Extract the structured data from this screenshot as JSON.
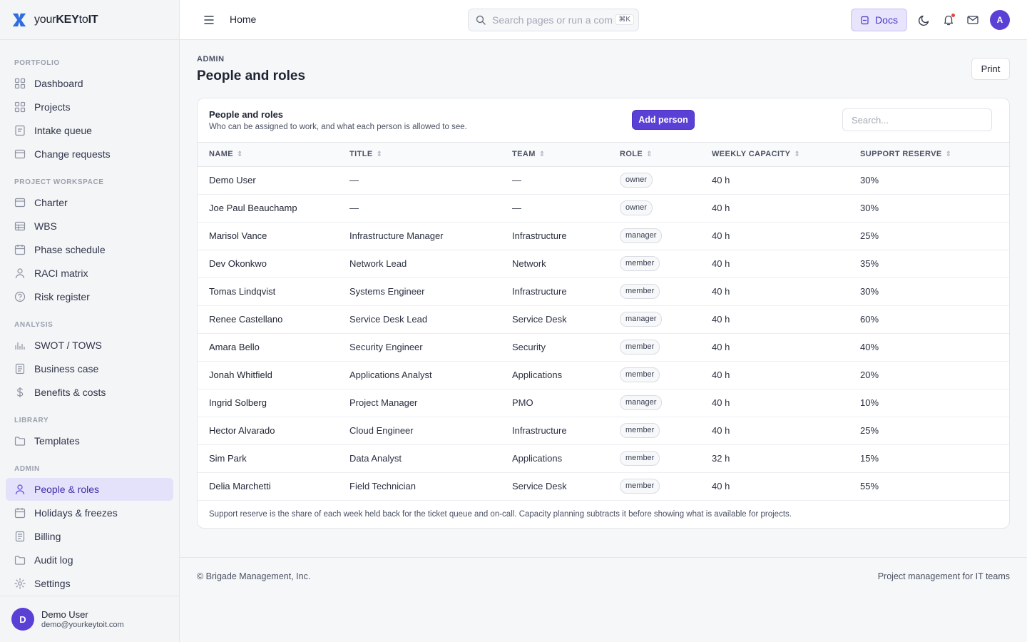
{
  "brand": {
    "prefix": "your",
    "key": "KEY",
    "to": "to",
    "it": "IT"
  },
  "sidebar": {
    "sections": [
      {
        "label": "PORTFOLIO",
        "items": [
          {
            "label": "Dashboard",
            "icon": "grid-icon"
          },
          {
            "label": "Projects",
            "icon": "grid-icon"
          },
          {
            "label": "Intake queue",
            "icon": "form-icon"
          },
          {
            "label": "Change requests",
            "icon": "window-icon"
          }
        ]
      },
      {
        "label": "PROJECT WORKSPACE",
        "items": [
          {
            "label": "Charter",
            "icon": "window-icon"
          },
          {
            "label": "WBS",
            "icon": "table-icon"
          },
          {
            "label": "Phase schedule",
            "icon": "calendar-icon"
          },
          {
            "label": "RACI matrix",
            "icon": "user-icon"
          },
          {
            "label": "Risk register",
            "icon": "help-circle-icon"
          }
        ]
      },
      {
        "label": "ANALYSIS",
        "items": [
          {
            "label": "SWOT / TOWS",
            "icon": "bar-chart-icon"
          },
          {
            "label": "Business case",
            "icon": "document-icon"
          },
          {
            "label": "Benefits & costs",
            "icon": "dollar-icon"
          }
        ]
      },
      {
        "label": "LIBRARY",
        "items": [
          {
            "label": "Templates",
            "icon": "folder-icon"
          }
        ]
      },
      {
        "label": "ADMIN",
        "items": [
          {
            "label": "People & roles",
            "icon": "user-icon",
            "active": true
          },
          {
            "label": "Holidays & freezes",
            "icon": "calendar-icon"
          },
          {
            "label": "Billing",
            "icon": "document-icon"
          },
          {
            "label": "Audit log",
            "icon": "folder-icon"
          },
          {
            "label": "Settings",
            "icon": "gear-icon"
          }
        ]
      }
    ],
    "user": {
      "initial": "D",
      "name": "Demo User",
      "email": "demo@yourkeytoit.com"
    }
  },
  "topbar": {
    "breadcrumb": "Home",
    "search_placeholder": "Search pages or run a command",
    "search_shortcut": "⌘K",
    "docs_label": "Docs",
    "avatar_initial": "A"
  },
  "page": {
    "eyebrow": "ADMIN",
    "title": "People and roles",
    "print_label": "Print"
  },
  "card": {
    "title": "People and roles",
    "subtitle": "Who can be assigned to work, and what each person is allowed to see.",
    "add_label": "Add person",
    "search_placeholder": "Search...",
    "columns": [
      "NAME",
      "TITLE",
      "TEAM",
      "ROLE",
      "WEEKLY CAPACITY",
      "SUPPORT RESERVE"
    ],
    "rows": [
      {
        "name": "Demo User",
        "title": "—",
        "team": "—",
        "role": "owner",
        "capacity": "40 h",
        "reserve": "30%"
      },
      {
        "name": "Joe Paul Beauchamp",
        "title": "—",
        "team": "—",
        "role": "owner",
        "capacity": "40 h",
        "reserve": "30%"
      },
      {
        "name": "Marisol Vance",
        "title": "Infrastructure Manager",
        "team": "Infrastructure",
        "role": "manager",
        "capacity": "40 h",
        "reserve": "25%"
      },
      {
        "name": "Dev Okonkwo",
        "title": "Network Lead",
        "team": "Network",
        "role": "member",
        "capacity": "40 h",
        "reserve": "35%"
      },
      {
        "name": "Tomas Lindqvist",
        "title": "Systems Engineer",
        "team": "Infrastructure",
        "role": "member",
        "capacity": "40 h",
        "reserve": "30%"
      },
      {
        "name": "Renee Castellano",
        "title": "Service Desk Lead",
        "team": "Service Desk",
        "role": "manager",
        "capacity": "40 h",
        "reserve": "60%"
      },
      {
        "name": "Amara Bello",
        "title": "Security Engineer",
        "team": "Security",
        "role": "member",
        "capacity": "40 h",
        "reserve": "40%"
      },
      {
        "name": "Jonah Whitfield",
        "title": "Applications Analyst",
        "team": "Applications",
        "role": "member",
        "capacity": "40 h",
        "reserve": "20%"
      },
      {
        "name": "Ingrid Solberg",
        "title": "Project Manager",
        "team": "PMO",
        "role": "manager",
        "capacity": "40 h",
        "reserve": "10%"
      },
      {
        "name": "Hector Alvarado",
        "title": "Cloud Engineer",
        "team": "Infrastructure",
        "role": "member",
        "capacity": "40 h",
        "reserve": "25%"
      },
      {
        "name": "Sim Park",
        "title": "Data Analyst",
        "team": "Applications",
        "role": "member",
        "capacity": "32 h",
        "reserve": "15%"
      },
      {
        "name": "Delia Marchetti",
        "title": "Field Technician",
        "team": "Service Desk",
        "role": "member",
        "capacity": "40 h",
        "reserve": "55%"
      }
    ],
    "footnote": "Support reserve is the share of each week held back for the ticket queue and on-call. Capacity planning subtracts it before showing what is available for projects."
  },
  "footer": {
    "left": "© Brigade Management, Inc.",
    "right": "Project management for IT teams"
  },
  "colors": {
    "accent": "#5b40d6",
    "accent_soft": "#e4e1fb",
    "notification": "#e2463f"
  }
}
